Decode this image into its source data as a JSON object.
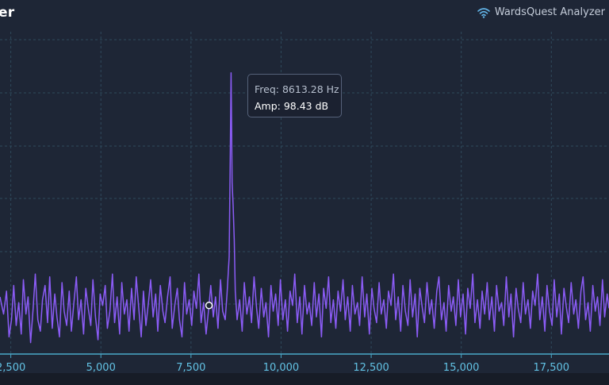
{
  "header": {
    "title": "er",
    "brand": "WardsQuest Analyzer",
    "brand_icon": "wifi-icon"
  },
  "tooltip": {
    "freq": "Freq: 8613.28 Hz",
    "amp": "Amp: 98.43 dB"
  },
  "colors": {
    "line": "#8b5cf6",
    "grid": "#2f4a5c",
    "axis": "#4aa8c8",
    "tick_label": "#62c2e4",
    "background": "#1e2636"
  },
  "chart_data": {
    "type": "line",
    "x_tick_labels": [
      "2,500",
      "5,000",
      "7,500",
      "10,000",
      "12,500",
      "15,000",
      "17,500"
    ],
    "x_ticks": [
      2500,
      5000,
      7500,
      10000,
      12500,
      15000,
      17500
    ],
    "xlim": [
      2200,
      19100
    ],
    "ylim": [
      0,
      110
    ],
    "grid": true,
    "hover_point": {
      "x": 8000,
      "y": 17
    },
    "peak": {
      "x": 8613.28,
      "y": 98.43
    },
    "series": [
      {
        "values": [
          [
            2200,
            20
          ],
          [
            2300,
            14
          ],
          [
            2380,
            22
          ],
          [
            2450,
            6
          ],
          [
            2520,
            12
          ],
          [
            2580,
            24
          ],
          [
            2650,
            10
          ],
          [
            2720,
            18
          ],
          [
            2790,
            7
          ],
          [
            2850,
            26
          ],
          [
            2920,
            14
          ],
          [
            2980,
            20
          ],
          [
            3050,
            4
          ],
          [
            3120,
            16
          ],
          [
            3180,
            28
          ],
          [
            3250,
            12
          ],
          [
            3320,
            8
          ],
          [
            3380,
            19
          ],
          [
            3450,
            24
          ],
          [
            3520,
            11
          ],
          [
            3580,
            27
          ],
          [
            3650,
            9
          ],
          [
            3720,
            21
          ],
          [
            3780,
            13
          ],
          [
            3850,
            6
          ],
          [
            3920,
            25
          ],
          [
            3980,
            15
          ],
          [
            4050,
            10
          ],
          [
            4120,
            22
          ],
          [
            4180,
            8
          ],
          [
            4250,
            18
          ],
          [
            4320,
            27
          ],
          [
            4380,
            12
          ],
          [
            4450,
            19
          ],
          [
            4520,
            7
          ],
          [
            4580,
            23
          ],
          [
            4650,
            16
          ],
          [
            4720,
            10
          ],
          [
            4780,
            26
          ],
          [
            4850,
            13
          ],
          [
            4920,
            5
          ],
          [
            4980,
            21
          ],
          [
            5050,
            17
          ],
          [
            5120,
            24
          ],
          [
            5180,
            9
          ],
          [
            5250,
            15
          ],
          [
            5320,
            28
          ],
          [
            5380,
            11
          ],
          [
            5450,
            20
          ],
          [
            5520,
            7
          ],
          [
            5580,
            25
          ],
          [
            5650,
            14
          ],
          [
            5720,
            19
          ],
          [
            5780,
            8
          ],
          [
            5850,
            23
          ],
          [
            5920,
            12
          ],
          [
            5980,
            27
          ],
          [
            6050,
            16
          ],
          [
            6120,
            6
          ],
          [
            6180,
            22
          ],
          [
            6250,
            10
          ],
          [
            6320,
            18
          ],
          [
            6380,
            26
          ],
          [
            6450,
            13
          ],
          [
            6520,
            21
          ],
          [
            6580,
            8
          ],
          [
            6650,
            24
          ],
          [
            6720,
            15
          ],
          [
            6780,
            11
          ],
          [
            6850,
            20
          ],
          [
            6920,
            27
          ],
          [
            6980,
            9
          ],
          [
            7050,
            17
          ],
          [
            7120,
            23
          ],
          [
            7180,
            12
          ],
          [
            7250,
            6
          ],
          [
            7320,
            25
          ],
          [
            7380,
            14
          ],
          [
            7450,
            19
          ],
          [
            7520,
            10
          ],
          [
            7580,
            22
          ],
          [
            7650,
            16
          ],
          [
            7720,
            28
          ],
          [
            7780,
            11
          ],
          [
            7850,
            18
          ],
          [
            7920,
            7
          ],
          [
            8000,
            17
          ],
          [
            8050,
            24
          ],
          [
            8120,
            13
          ],
          [
            8180,
            20
          ],
          [
            8250,
            9
          ],
          [
            8320,
            26
          ],
          [
            8380,
            15
          ],
          [
            8450,
            12
          ],
          [
            8500,
            21
          ],
          [
            8560,
            34
          ],
          [
            8590,
            70
          ],
          [
            8613.28,
            98.43
          ],
          [
            8640,
            60
          ],
          [
            8670,
            52
          ],
          [
            8700,
            40
          ],
          [
            8730,
            22
          ],
          [
            8780,
            12
          ],
          [
            8850,
            19
          ],
          [
            8920,
            8
          ],
          [
            8980,
            25
          ],
          [
            9050,
            14
          ],
          [
            9120,
            20
          ],
          [
            9180,
            11
          ],
          [
            9250,
            27
          ],
          [
            9320,
            16
          ],
          [
            9380,
            9
          ],
          [
            9450,
            23
          ],
          [
            9520,
            13
          ],
          [
            9580,
            18
          ],
          [
            9650,
            6
          ],
          [
            9720,
            24
          ],
          [
            9780,
            15
          ],
          [
            9850,
            21
          ],
          [
            9920,
            10
          ],
          [
            9980,
            26
          ],
          [
            10050,
            12
          ],
          [
            10120,
            19
          ],
          [
            10180,
            8
          ],
          [
            10250,
            22
          ],
          [
            10320,
            17
          ],
          [
            10380,
            28
          ],
          [
            10450,
            11
          ],
          [
            10520,
            20
          ],
          [
            10580,
            7
          ],
          [
            10650,
            24
          ],
          [
            10720,
            14
          ],
          [
            10780,
            18
          ],
          [
            10850,
            10
          ],
          [
            10920,
            25
          ],
          [
            10980,
            13
          ],
          [
            11050,
            21
          ],
          [
            11120,
            6
          ],
          [
            11180,
            23
          ],
          [
            11250,
            16
          ],
          [
            11320,
            27
          ],
          [
            11380,
            11
          ],
          [
            11450,
            19
          ],
          [
            11520,
            9
          ],
          [
            11580,
            22
          ],
          [
            11650,
            15
          ],
          [
            11720,
            26
          ],
          [
            11780,
            12
          ],
          [
            11850,
            20
          ],
          [
            11920,
            8
          ],
          [
            11980,
            24
          ],
          [
            12050,
            14
          ],
          [
            12120,
            18
          ],
          [
            12180,
            10
          ],
          [
            12250,
            27
          ],
          [
            12320,
            13
          ],
          [
            12380,
            21
          ],
          [
            12450,
            7
          ],
          [
            12520,
            23
          ],
          [
            12580,
            16
          ],
          [
            12650,
            11
          ],
          [
            12720,
            25
          ],
          [
            12780,
            14
          ],
          [
            12850,
            19
          ],
          [
            12920,
            9
          ],
          [
            12980,
            22
          ],
          [
            13050,
            17
          ],
          [
            13120,
            28
          ],
          [
            13180,
            12
          ],
          [
            13250,
            20
          ],
          [
            13320,
            8
          ],
          [
            13380,
            24
          ],
          [
            13450,
            15
          ],
          [
            13520,
            10
          ],
          [
            13580,
            26
          ],
          [
            13650,
            13
          ],
          [
            13720,
            21
          ],
          [
            13780,
            6
          ],
          [
            13850,
            23
          ],
          [
            13920,
            16
          ],
          [
            13980,
            11
          ],
          [
            14050,
            25
          ],
          [
            14120,
            14
          ],
          [
            14180,
            19
          ],
          [
            14250,
            9
          ],
          [
            14320,
            22
          ],
          [
            14380,
            27
          ],
          [
            14450,
            12
          ],
          [
            14520,
            18
          ],
          [
            14580,
            8
          ],
          [
            14650,
            24
          ],
          [
            14720,
            15
          ],
          [
            14780,
            20
          ],
          [
            14850,
            10
          ],
          [
            14920,
            26
          ],
          [
            14980,
            13
          ],
          [
            15050,
            21
          ],
          [
            15120,
            7
          ],
          [
            15180,
            23
          ],
          [
            15250,
            16
          ],
          [
            15320,
            28
          ],
          [
            15380,
            11
          ],
          [
            15450,
            19
          ],
          [
            15520,
            9
          ],
          [
            15580,
            22
          ],
          [
            15650,
            14
          ],
          [
            15720,
            25
          ],
          [
            15780,
            12
          ],
          [
            15850,
            20
          ],
          [
            15920,
            8
          ],
          [
            15980,
            24
          ],
          [
            16050,
            15
          ],
          [
            16120,
            18
          ],
          [
            16180,
            10
          ],
          [
            16250,
            27
          ],
          [
            16320,
            13
          ],
          [
            16380,
            21
          ],
          [
            16450,
            6
          ],
          [
            16520,
            23
          ],
          [
            16580,
            16
          ],
          [
            16650,
            11
          ],
          [
            16720,
            25
          ],
          [
            16780,
            14
          ],
          [
            16850,
            19
          ],
          [
            16920,
            9
          ],
          [
            16980,
            22
          ],
          [
            17050,
            17
          ],
          [
            17120,
            28
          ],
          [
            17180,
            12
          ],
          [
            17250,
            20
          ],
          [
            17320,
            8
          ],
          [
            17380,
            24
          ],
          [
            17450,
            15
          ],
          [
            17520,
            10
          ],
          [
            17580,
            26
          ],
          [
            17650,
            13
          ],
          [
            17720,
            21
          ],
          [
            17780,
            7
          ],
          [
            17850,
            23
          ],
          [
            17920,
            16
          ],
          [
            17980,
            11
          ],
          [
            18050,
            25
          ],
          [
            18120,
            14
          ],
          [
            18180,
            19
          ],
          [
            18250,
            9
          ],
          [
            18320,
            22
          ],
          [
            18380,
            27
          ],
          [
            18450,
            12
          ],
          [
            18520,
            18
          ],
          [
            18580,
            8
          ],
          [
            18650,
            24
          ],
          [
            18720,
            15
          ],
          [
            18780,
            20
          ],
          [
            18850,
            10
          ],
          [
            18920,
            26
          ],
          [
            18980,
            13
          ],
          [
            19050,
            21
          ],
          [
            19100,
            16
          ]
        ]
      }
    ]
  }
}
